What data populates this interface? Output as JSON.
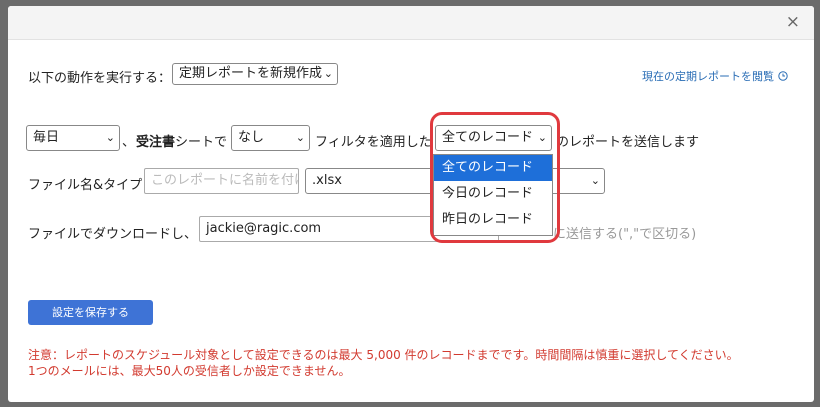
{
  "dialog": {
    "close_glyph": "×"
  },
  "action": {
    "label": "以下の動作を実行する：",
    "selected": "定期レポートを新規作成"
  },
  "view_link": {
    "label": "現在の定期レポートを閲覧",
    "icon": "clock-icon"
  },
  "schedule": {
    "frequency": "毎日",
    "separator": "、",
    "sheet_name": "受注書",
    "sheet_suffix": "シートで",
    "filter": "なし",
    "filter_suffix": "フィルタを適用した",
    "record_scope": "全てのレコード",
    "send_suffix": "のレポートを送信します"
  },
  "record_options": [
    "全てのレコード",
    "今日のレコード",
    "昨日のレコード"
  ],
  "file": {
    "label": "ファイル名&タイプ",
    "name_placeholder": "このレポートに名前を付け",
    "type": ".xlsx"
  },
  "download": {
    "label": "ファイルでダウンロードし、",
    "email": "jackie@ragic.com",
    "hint": "に送信する(\",\"で区切る)"
  },
  "save_button": "設定を保存する",
  "warnings": [
    "注意：レポートのスケジュール対象として設定できるのは最大 5,000 件のレコードまでです。時間間隔は慎重に選択してください。",
    "1つのメールには、最大50人の受信者しか設定できません。"
  ],
  "colors": {
    "accent": "#3e73d6",
    "warning": "#d23a2f",
    "highlight": "#e0393e",
    "link": "#2a6db5"
  }
}
